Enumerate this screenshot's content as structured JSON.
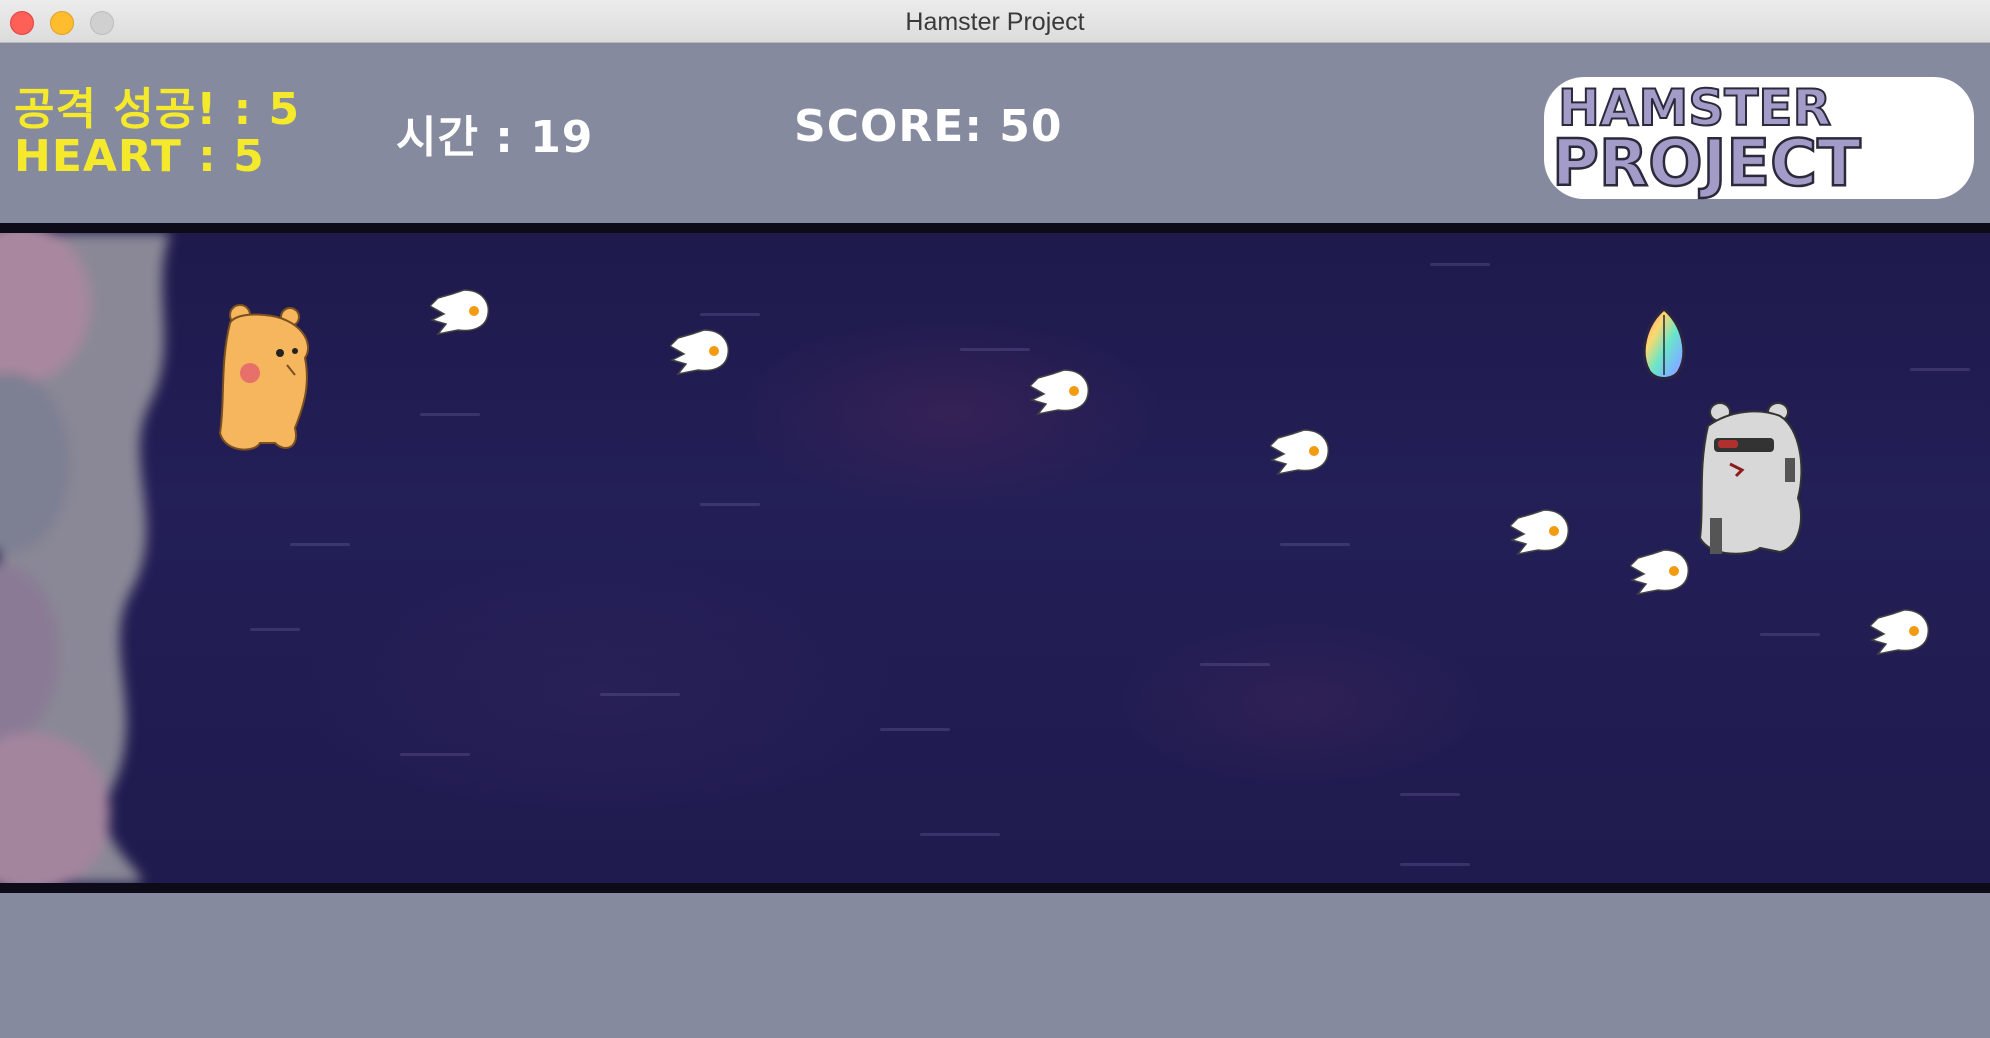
{
  "window": {
    "title": "Hamster Project"
  },
  "hud": {
    "attack_text": "공격 성공! : 5",
    "heart_text": "HEART : 5",
    "time_text": "시간 : 19",
    "score_text": "SCORE: 50",
    "logo_line1": "HAMSTER",
    "logo_line2": "PROJECT"
  },
  "colors": {
    "hud_bg": "#868a9e",
    "hud_yellow": "#f4ea2b",
    "field_bg": "#221e52",
    "hamster": "#f5b65e",
    "logo_fill": "#a49cc8"
  },
  "sprites": {
    "player": "orange-hamster",
    "enemy": "grey-hamster-with-sunglasses",
    "item": "rainbow-seed",
    "projectile": "white-ghost-bullet"
  }
}
